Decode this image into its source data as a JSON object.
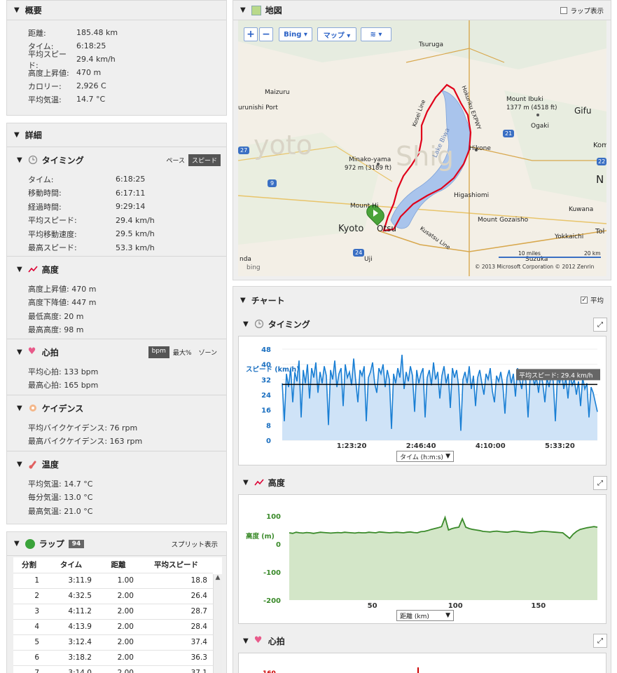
{
  "colors": {
    "speed": "#1a7fd4",
    "elev": "#3a8a2a",
    "route": "#e0001a",
    "lake": "#a9c4ec"
  },
  "summary": {
    "title": "概要",
    "rows": [
      {
        "k": "距離:",
        "v": "185.48 km"
      },
      {
        "k": "タイム:",
        "v": "6:18:25"
      },
      {
        "k": "平均スピード:",
        "v": "29.4 km/h"
      },
      {
        "k": "高度上昇値:",
        "v": "470 m"
      },
      {
        "k": "カロリー:",
        "v": "2,926 C"
      },
      {
        "k": "平均気温:",
        "v": "14.7 °C"
      }
    ]
  },
  "details": {
    "title": "詳細",
    "timing": {
      "title": "タイミング",
      "toggle": [
        "ペース",
        "スピード"
      ],
      "rows": [
        {
          "k": "タイム:",
          "v": "6:18:25"
        },
        {
          "k": "移動時間:",
          "v": "6:17:11"
        },
        {
          "k": "経過時間:",
          "v": "9:29:14"
        },
        {
          "k": "平均スピード:",
          "v": "29.4 km/h"
        },
        {
          "k": "平均移動速度:",
          "v": "29.5 km/h"
        },
        {
          "k": "最高スピード:",
          "v": "53.3 km/h"
        }
      ]
    },
    "elevation": {
      "title": "高度",
      "rows": [
        "高度上昇値: 470 m",
        "高度下降値: 447 m",
        "最低高度:   20 m",
        "最高高度:   98 m"
      ]
    },
    "hr": {
      "title": "心拍",
      "toggle": [
        "bpm",
        "最大%",
        "ゾーン"
      ],
      "rows": [
        "平均心拍: 133 bpm",
        "最高心拍: 165 bpm"
      ]
    },
    "cadence": {
      "title": "ケイデンス",
      "rows": [
        "平均バイクケイデンス: 76 rpm",
        "最高バイクケイデンス: 163 rpm"
      ]
    },
    "temp": {
      "title": "温度",
      "rows": [
        "平均気温: 14.7 °C",
        "毎分気温: 13.0 °C",
        "最高気温: 21.0 °C"
      ]
    }
  },
  "laps": {
    "title": "ラップ",
    "count": "94",
    "split_link": "スプリット表示",
    "headers": [
      "分割",
      "タイム",
      "距離",
      "平均スピード"
    ],
    "rows": [
      [
        "1",
        "3:11.9",
        "1.00",
        "18.8"
      ],
      [
        "2",
        "4:32.5",
        "2.00",
        "26.4"
      ],
      [
        "3",
        "4:11.2",
        "2.00",
        "28.7"
      ],
      [
        "4",
        "4:13.9",
        "2.00",
        "28.4"
      ],
      [
        "5",
        "3:12.4",
        "2.00",
        "37.4"
      ],
      [
        "6",
        "3:18.2",
        "2.00",
        "36.3"
      ],
      [
        "7",
        "3:14.0",
        "2.00",
        "37.1"
      ]
    ]
  },
  "map": {
    "title": "地図",
    "lap_toggle": "ラップ表示",
    "buttons": {
      "plus": "+",
      "minus": "−",
      "bing": "Bing ▾",
      "map": "マップ ▾",
      "layers": "≋ ▾"
    },
    "labels": {
      "tsuruga": "Tsuruga",
      "maizuru": "Maizuru",
      "port": "urunishi Port",
      "ibuki": "Mount Ibuki",
      "ibuki_h": "1377 m (4518 ft)",
      "gifu": "Gifu",
      "ogaki": "Ogaki",
      "hikone": "Hikone",
      "minako": "Minako-yama",
      "minako_h": "972 m (3189 ft)",
      "higashiomi": "Higashiomi",
      "kuwana": "Kuwana",
      "gozaisho": "Mount Gozaisho",
      "yokkaichi": "Yokkaichi",
      "kyoto": "Kyoto",
      "otsu": "Otsu",
      "uji": "Uji",
      "suzuka": "Suzuka",
      "lake": "Lake Biwa",
      "kyoto_big": "yoto",
      "shiga_big": "Shig",
      "copyright": "© 2013 Microsoft Corporation   © 2012 Zenrin",
      "scale_mi": "10 miles",
      "scale_km": "20 km",
      "bing": "bing",
      "nda": "nda",
      "tol": "Tol",
      "kom": "Kom",
      "n": "N",
      "mounthi": "Mount Hi",
      "kosei": "Kosei Line",
      "hokuriku": "Hokuriku EXPWY",
      "kusatsu": "Kusatsu Line",
      "r27": "27",
      "r9": "9",
      "r21": "21",
      "r22": "22",
      "r24": "24"
    }
  },
  "charts": {
    "title": "チャート",
    "avg_toggle": "平均",
    "timing": {
      "title": "タイミング",
      "axis_select": "タイム (h:m:s)"
    },
    "elevation": {
      "title": "高度",
      "axis_select": "距離 (km)"
    },
    "hr": {
      "title": "心拍",
      "y_tick": "160"
    }
  },
  "chart_data": [
    {
      "type": "line",
      "title": "タイミング",
      "ylabel": "スピード (km/h)",
      "ylim": [
        0,
        48
      ],
      "yticks": [
        0,
        8,
        16,
        24,
        32,
        40,
        48
      ],
      "xticks": [
        "1:23:20",
        "2:46:40",
        "4:10:00",
        "5:33:20"
      ],
      "x_range": [
        0,
        22705
      ],
      "average_label": "平均スピード: 29.4 km/h",
      "average": 29.4,
      "series": [
        {
          "values": [
            30,
            10,
            35,
            28,
            38,
            20,
            36,
            31,
            42,
            12,
            37,
            30,
            40,
            22,
            38,
            33,
            41,
            25,
            36,
            30,
            39,
            34,
            8,
            37,
            32,
            42,
            28,
            35,
            38,
            18,
            40,
            33,
            36,
            29,
            43,
            31,
            20,
            37,
            34,
            39,
            10,
            33,
            36,
            41,
            30,
            25,
            38,
            35,
            40,
            28,
            37,
            32,
            6,
            35,
            30,
            38,
            33,
            45,
            27,
            36,
            31,
            39,
            34,
            15,
            37,
            30,
            35,
            38,
            12,
            33,
            37,
            29,
            41,
            32,
            36,
            22,
            34,
            39,
            30,
            35,
            17,
            38,
            33,
            37,
            28,
            5,
            32,
            36,
            30,
            39,
            27,
            34,
            18,
            33,
            37,
            30,
            24,
            35,
            32,
            38,
            26,
            20,
            34,
            31,
            36,
            29,
            14,
            33,
            37,
            30,
            35,
            23,
            38,
            32,
            27,
            36,
            31,
            12,
            34,
            37,
            29,
            33,
            25,
            36,
            30,
            20,
            33,
            28,
            35,
            31,
            10,
            34,
            30,
            36,
            27,
            33,
            22,
            35,
            29,
            32,
            24,
            31,
            18,
            33,
            27,
            30,
            12,
            28,
            25,
            20,
            15
          ]
        }
      ]
    },
    {
      "type": "line",
      "title": "高度",
      "ylabel": "高度 (m)",
      "ylim": [
        -200,
        100
      ],
      "yticks": [
        100,
        0,
        -100,
        -200
      ],
      "xticks": [
        50,
        100,
        150
      ],
      "x_range": [
        0,
        185.48
      ],
      "series": [
        {
          "values": [
            40,
            38,
            42,
            40,
            39,
            41,
            40,
            38,
            40,
            42,
            41,
            40,
            39,
            40,
            41,
            40,
            42,
            41,
            40,
            39,
            41,
            40,
            40,
            42,
            41,
            40,
            43,
            42,
            41,
            40,
            41,
            42,
            41,
            40,
            42,
            43,
            41,
            40,
            44,
            45,
            48,
            52,
            55,
            58,
            62,
            95,
            50,
            55,
            58,
            60,
            90,
            60,
            55,
            52,
            50,
            48,
            45,
            44,
            43,
            45,
            46,
            44,
            43,
            42,
            44,
            46,
            45,
            43,
            42,
            41,
            40,
            42,
            44,
            46,
            45,
            44,
            43,
            42,
            41,
            40,
            30,
            20,
            35,
            45,
            52,
            55,
            58,
            60,
            62,
            60
          ]
        }
      ]
    },
    {
      "type": "line",
      "title": "心拍",
      "ylabel": "",
      "yticks": [
        160
      ]
    }
  ]
}
